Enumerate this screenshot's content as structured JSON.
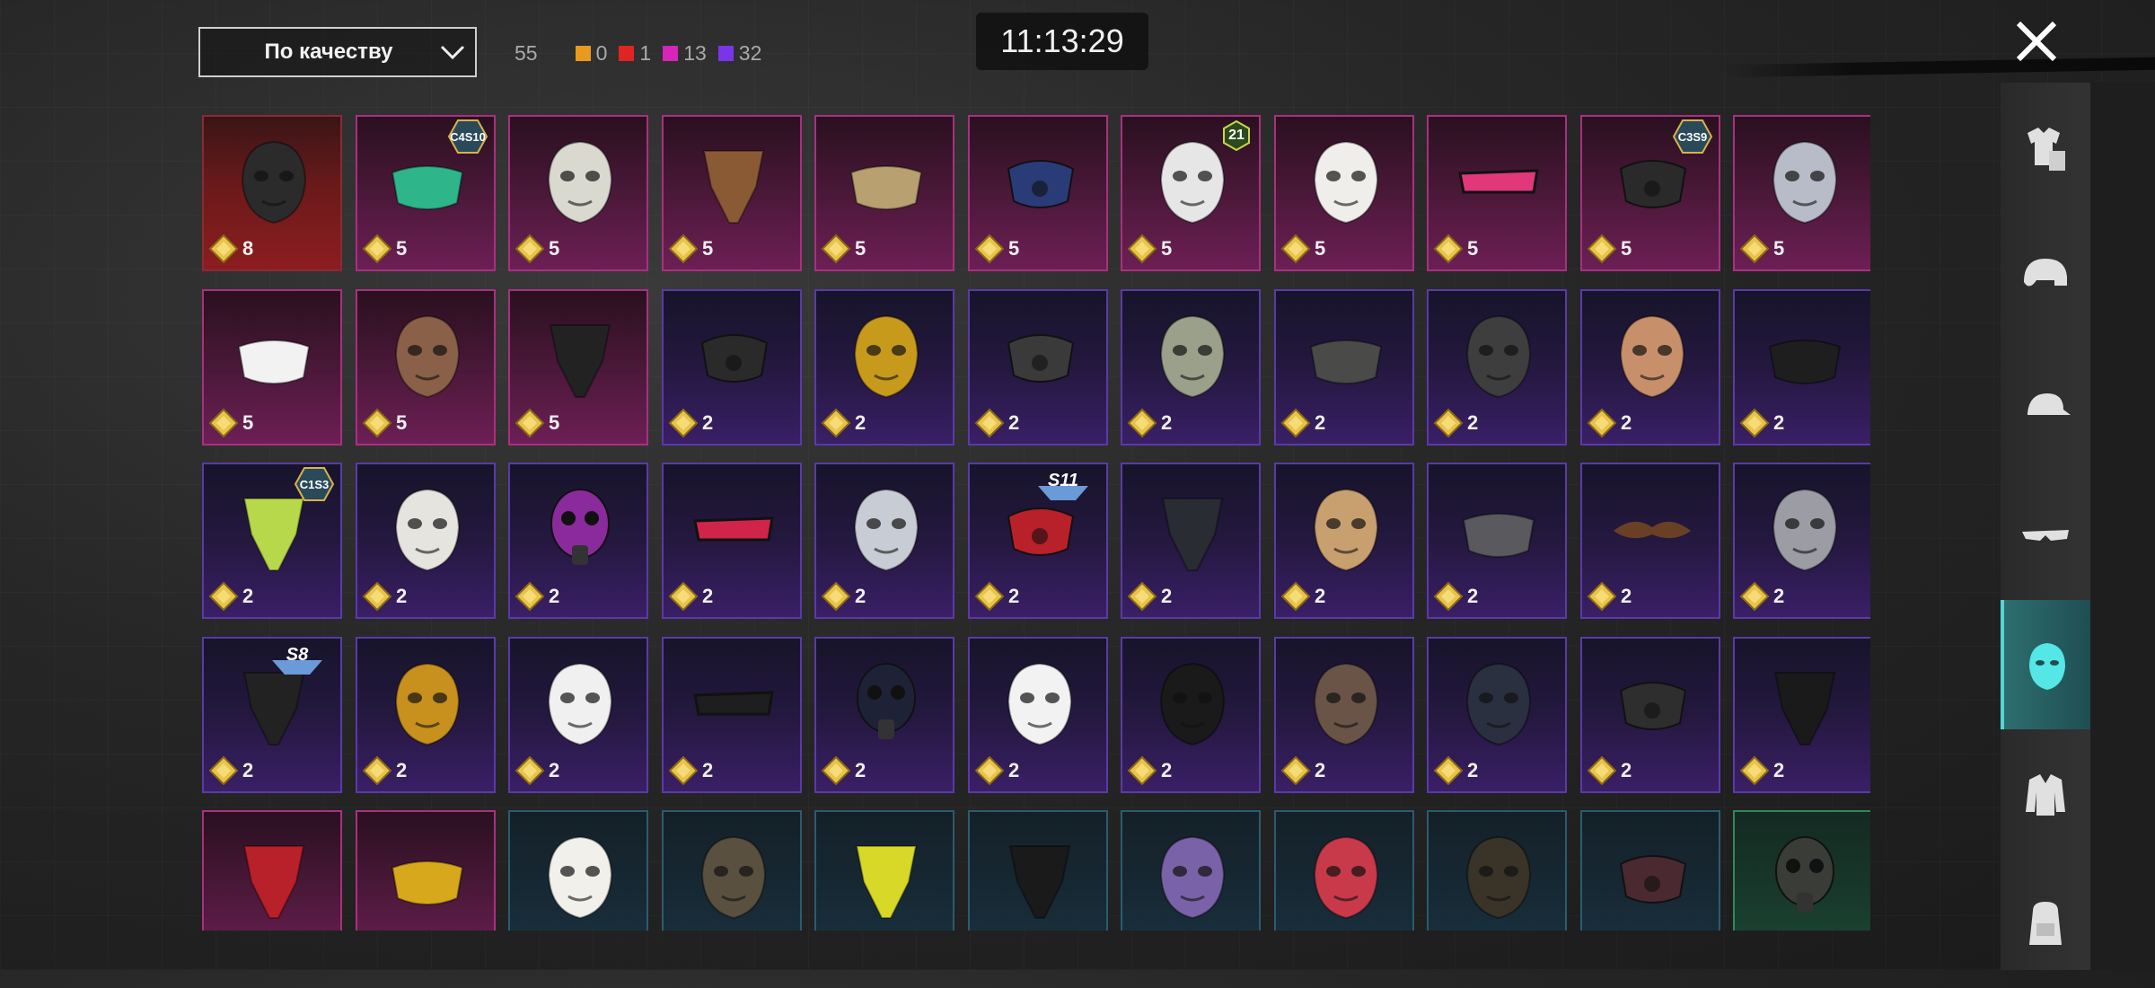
{
  "header": {
    "sort_label": "По качеству",
    "total_count": "55",
    "rarity_counts": [
      {
        "value": "0",
        "color": "#e89a1c"
      },
      {
        "value": "1",
        "color": "#e02424"
      },
      {
        "value": "13",
        "color": "#d625b8"
      },
      {
        "value": "32",
        "color": "#7a35e8"
      }
    ],
    "clock": "11:13:29"
  },
  "sidebar": {
    "items": [
      {
        "icon": "outfit-icon",
        "active": false
      },
      {
        "icon": "helmet-icon",
        "active": false
      },
      {
        "icon": "cap-icon",
        "active": false
      },
      {
        "icon": "glasses-icon",
        "active": false
      },
      {
        "icon": "mask-icon",
        "active": true
      },
      {
        "icon": "jacket-icon",
        "active": false
      },
      {
        "icon": "backpack-icon",
        "active": false
      }
    ]
  },
  "items": [
    {
      "q": "red",
      "count": "8",
      "art": "dark-skull-mask",
      "c": "#2b2b2b"
    },
    {
      "q": "pink",
      "count": "5",
      "art": "green-face-mask",
      "c": "#2fb58a",
      "badge": "C4S10"
    },
    {
      "q": "pink",
      "count": "5",
      "art": "cat-mask",
      "c": "#d9d9d0"
    },
    {
      "q": "pink",
      "count": "5",
      "art": "brown-bandana",
      "c": "#8a5a35"
    },
    {
      "q": "pink",
      "count": "5",
      "art": "gold-face-mask",
      "c": "#b8a070"
    },
    {
      "q": "pink",
      "count": "5",
      "art": "blue-respirator",
      "c": "#2a3c78"
    },
    {
      "q": "pink",
      "count": "5",
      "art": "clown-mask",
      "c": "#e6e6e6",
      "level": "21"
    },
    {
      "q": "pink",
      "count": "5",
      "art": "fox-mask",
      "c": "#f0eeea"
    },
    {
      "q": "pink",
      "count": "5",
      "art": "pink-visor",
      "c": "#e0387a"
    },
    {
      "q": "pink",
      "count": "5",
      "art": "neon-respirator",
      "c": "#2a2a2a",
      "badge": "C3S9"
    },
    {
      "q": "pink",
      "count": "5",
      "art": "monster-mask",
      "c": "#b8bcc8"
    },
    {
      "q": "pink",
      "count": "5",
      "art": "white-face-mask",
      "c": "#f2f2f2"
    },
    {
      "q": "pink",
      "count": "5",
      "art": "plague-mask",
      "c": "#8a6048"
    },
    {
      "q": "pink",
      "count": "5",
      "art": "skull-bandana",
      "c": "#222"
    },
    {
      "q": "purple",
      "count": "2",
      "art": "black-respirator",
      "c": "#2a2a2a"
    },
    {
      "q": "purple",
      "count": "2",
      "art": "gold-masquerade",
      "c": "#c89a1c"
    },
    {
      "q": "purple",
      "count": "2",
      "art": "grey-respirator",
      "c": "#3a3a3a"
    },
    {
      "q": "purple",
      "count": "2",
      "art": "hockey-mask",
      "c": "#9aa08a"
    },
    {
      "q": "purple",
      "count": "2",
      "art": "dark-face-mask",
      "c": "#4a4a48"
    },
    {
      "q": "purple",
      "count": "2",
      "art": "tactical-mask",
      "c": "#3e3e3e"
    },
    {
      "q": "purple",
      "count": "2",
      "art": "mammoth-mask",
      "c": "#c8906a"
    },
    {
      "q": "purple",
      "count": "2",
      "art": "smile-face-mask",
      "c": "#1e1e1e"
    },
    {
      "q": "purple",
      "count": "2",
      "art": "cactus-bandana",
      "c": "#b6d84a",
      "badge": "C1S3"
    },
    {
      "q": "purple",
      "count": "2",
      "art": "skull-face",
      "c": "#e6e4de"
    },
    {
      "q": "purple",
      "count": "2",
      "art": "purple-gasmask",
      "c": "#8a2a9c"
    },
    {
      "q": "purple",
      "count": "2",
      "art": "red-visor",
      "c": "#d0244a"
    },
    {
      "q": "purple",
      "count": "2",
      "art": "steel-helm-mask",
      "c": "#c8ccd4"
    },
    {
      "q": "purple",
      "count": "2",
      "art": "red-respirator",
      "c": "#b8202a",
      "sbadge": "S11"
    },
    {
      "q": "purple",
      "count": "2",
      "art": "black-bandana",
      "c": "#2a2c34"
    },
    {
      "q": "purple",
      "count": "2",
      "art": "gas-mask",
      "c": "#c8a070"
    },
    {
      "q": "purple",
      "count": "2",
      "art": "grey-face-mask",
      "c": "#5a5a5e"
    },
    {
      "q": "purple",
      "count": "2",
      "art": "mustache",
      "c": "#6a4024"
    },
    {
      "q": "purple",
      "count": "2",
      "art": "bandaged-mask",
      "c": "#9c9ca4"
    },
    {
      "q": "purple",
      "count": "2",
      "art": "flame-bandana",
      "c": "#222",
      "sbadge": "S8"
    },
    {
      "q": "purple",
      "count": "2",
      "art": "studded-mask",
      "c": "#c8901c"
    },
    {
      "q": "purple",
      "count": "2",
      "art": "joker-mask",
      "c": "#f0f0f0"
    },
    {
      "q": "purple",
      "count": "2",
      "art": "pixel-glasses",
      "c": "#1e1e1e"
    },
    {
      "q": "purple",
      "count": "2",
      "art": "diver-gasmask",
      "c": "#1e2236"
    },
    {
      "q": "purple",
      "count": "2",
      "art": "fang-mask-white",
      "c": "#f2f2f2"
    },
    {
      "q": "purple",
      "count": "2",
      "art": "fang-mask-black",
      "c": "#1a1a1a"
    },
    {
      "q": "purple",
      "count": "2",
      "art": "rusty-mask",
      "c": "#6a5448"
    },
    {
      "q": "purple",
      "count": "2",
      "art": "demon-mask",
      "c": "#2a3040"
    },
    {
      "q": "purple",
      "count": "2",
      "art": "iron-muzzle",
      "c": "#2e2e2e"
    },
    {
      "q": "purple",
      "count": "2",
      "art": "plain-bandana",
      "c": "#1a1a1a"
    },
    {
      "q": "pink",
      "count": "",
      "art": "red-neckerchief",
      "c": "#b8202a"
    },
    {
      "q": "pink",
      "count": "",
      "art": "glitter-mask",
      "c": "#d8a81c"
    },
    {
      "q": "blue",
      "count": "",
      "art": "noh-mask",
      "c": "#f2f0ea"
    },
    {
      "q": "blue",
      "count": "",
      "art": "wood-skull-mask",
      "c": "#5a5040"
    },
    {
      "q": "blue",
      "count": "",
      "art": "yellow-net-bandana",
      "c": "#d8d828"
    },
    {
      "q": "blue",
      "count": "",
      "art": "spider-bandana",
      "c": "#1a1a1a"
    },
    {
      "q": "blue",
      "count": "",
      "art": "purple-theatre-mask",
      "c": "#7a62a8"
    },
    {
      "q": "blue",
      "count": "",
      "art": "red-theatre-mask",
      "c": "#c83a4a"
    },
    {
      "q": "blue",
      "count": "",
      "art": "gold-pattern-mask",
      "c": "#3a3428"
    },
    {
      "q": "blue",
      "count": "",
      "art": "dark-red-respirator",
      "c": "#4a2a30"
    },
    {
      "q": "green",
      "count": "",
      "art": "old-gasmask",
      "c": "#3a3c38"
    }
  ]
}
